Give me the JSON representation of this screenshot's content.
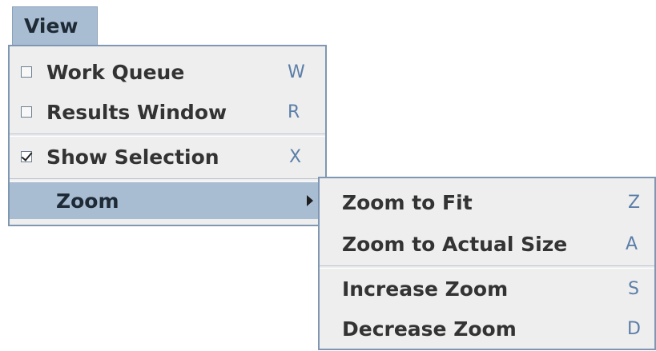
{
  "menubar": {
    "title": "View"
  },
  "view_menu": {
    "items": [
      {
        "label": "Work Queue",
        "shortcut": "W",
        "checked": false,
        "icon": "checkbox-unchecked-icon"
      },
      {
        "label": "Results Window",
        "shortcut": "R",
        "checked": false,
        "icon": "checkbox-unchecked-icon"
      },
      {
        "label": "Show Selection",
        "shortcut": "X",
        "checked": true,
        "icon": "checkbox-checked-icon"
      },
      {
        "label": "Zoom",
        "submenu": true,
        "icon": "submenu-arrow-icon"
      }
    ]
  },
  "zoom_menu": {
    "items": [
      {
        "label": "Zoom to Fit",
        "shortcut": "Z"
      },
      {
        "label": "Zoom to Actual Size",
        "shortcut": "A"
      },
      {
        "label": "Increase Zoom",
        "shortcut": "S"
      },
      {
        "label": "Decrease Zoom",
        "shortcut": "D"
      }
    ]
  },
  "colors": {
    "highlight": "#a9bdd2",
    "border": "#7f97b3",
    "menu_bg": "#eeeeee",
    "shortcut": "#5b7ea8"
  }
}
